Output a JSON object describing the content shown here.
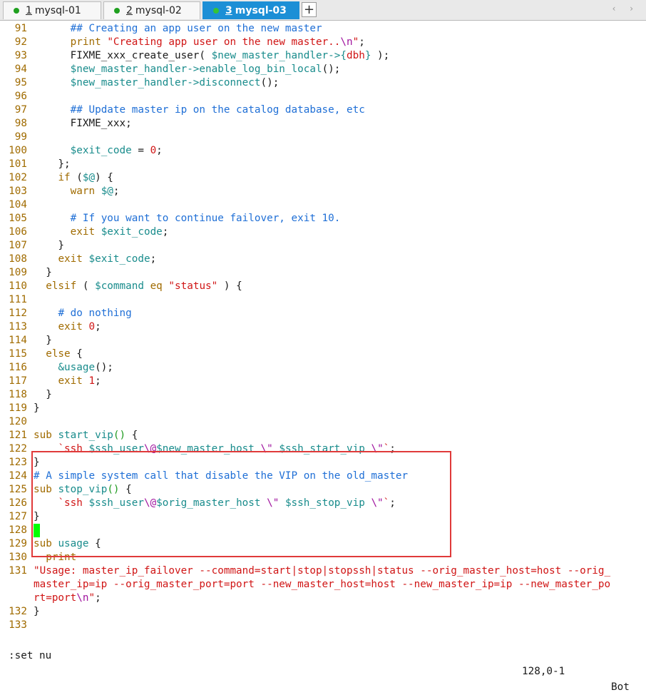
{
  "tabs": [
    {
      "number": "1",
      "label": "mysql-01",
      "active": false
    },
    {
      "number": "2",
      "label": "mysql-02",
      "active": false
    },
    {
      "number": "3",
      "label": "mysql-03",
      "active": true
    }
  ],
  "tab_add_label": "+",
  "tab_scroll_arrows": "‹ ›",
  "colors": {
    "comment": "#1f6fd6",
    "keyword": "#a06b00",
    "string": "#d01515",
    "variable": "#198c8c",
    "escape": "#a0149f",
    "cursor": "#00ff00",
    "highlight": "#e03a3a",
    "active_tab": "#1c8fd6"
  },
  "lines": [
    {
      "n": "91",
      "t": [
        [
          "      ",
          ""
        ],
        [
          "## Creating an app user on the new master",
          "cm"
        ]
      ]
    },
    {
      "n": "92",
      "t": [
        [
          "      ",
          ""
        ],
        [
          "print",
          "kw"
        ],
        [
          " ",
          ""
        ],
        [
          "\"Creating app user on the new master..",
          "str"
        ],
        [
          "\\n",
          "esc"
        ],
        [
          "\"",
          "str"
        ],
        [
          ";",
          ""
        ]
      ]
    },
    {
      "n": "93",
      "t": [
        [
          "      FIXME_xxx_create_user( ",
          ""
        ],
        [
          "$new_master_handler->{",
          "var"
        ],
        [
          "dbh",
          "str"
        ],
        [
          "}",
          "var"
        ],
        [
          " );",
          ""
        ]
      ]
    },
    {
      "n": "94",
      "t": [
        [
          "      ",
          ""
        ],
        [
          "$new_master_handler->enable_log_bin_local",
          "var"
        ],
        [
          "();",
          ""
        ]
      ]
    },
    {
      "n": "95",
      "t": [
        [
          "      ",
          ""
        ],
        [
          "$new_master_handler->disconnect",
          "var"
        ],
        [
          "();",
          ""
        ]
      ]
    },
    {
      "n": "96",
      "t": [
        [
          "",
          ""
        ]
      ]
    },
    {
      "n": "97",
      "t": [
        [
          "      ",
          ""
        ],
        [
          "## Update master ip on the catalog database, etc",
          "cm"
        ]
      ]
    },
    {
      "n": "98",
      "t": [
        [
          "      FIXME_xxx;",
          ""
        ]
      ]
    },
    {
      "n": "99",
      "t": [
        [
          "",
          ""
        ]
      ]
    },
    {
      "n": "100",
      "t": [
        [
          "      ",
          ""
        ],
        [
          "$exit_code",
          "var"
        ],
        [
          " = ",
          ""
        ],
        [
          "0",
          "str"
        ],
        [
          ";",
          ""
        ]
      ]
    },
    {
      "n": "101",
      "t": [
        [
          "    };",
          ""
        ]
      ]
    },
    {
      "n": "102",
      "t": [
        [
          "    ",
          ""
        ],
        [
          "if",
          "kw"
        ],
        [
          " (",
          ""
        ],
        [
          "$@",
          "var"
        ],
        [
          ") {",
          ""
        ]
      ]
    },
    {
      "n": "103",
      "t": [
        [
          "      ",
          ""
        ],
        [
          "warn",
          "kw"
        ],
        [
          " ",
          ""
        ],
        [
          "$@",
          "var"
        ],
        [
          ";",
          ""
        ]
      ]
    },
    {
      "n": "104",
      "t": [
        [
          "",
          ""
        ]
      ]
    },
    {
      "n": "105",
      "t": [
        [
          "      ",
          ""
        ],
        [
          "# If you want to continue failover, exit 10.",
          "cm"
        ]
      ]
    },
    {
      "n": "106",
      "t": [
        [
          "      ",
          ""
        ],
        [
          "exit",
          "kw"
        ],
        [
          " ",
          ""
        ],
        [
          "$exit_code",
          "var"
        ],
        [
          ";",
          ""
        ]
      ]
    },
    {
      "n": "107",
      "t": [
        [
          "    }",
          ""
        ]
      ]
    },
    {
      "n": "108",
      "t": [
        [
          "    ",
          ""
        ],
        [
          "exit",
          "kw"
        ],
        [
          " ",
          ""
        ],
        [
          "$exit_code",
          "var"
        ],
        [
          ";",
          ""
        ]
      ]
    },
    {
      "n": "109",
      "t": [
        [
          "  }",
          ""
        ]
      ]
    },
    {
      "n": "110",
      "t": [
        [
          "  ",
          ""
        ],
        [
          "elsif",
          "kw"
        ],
        [
          " ( ",
          ""
        ],
        [
          "$command",
          "var"
        ],
        [
          " ",
          ""
        ],
        [
          "eq",
          "kw"
        ],
        [
          " ",
          ""
        ],
        [
          "\"status\"",
          "str"
        ],
        [
          " ) {",
          ""
        ]
      ]
    },
    {
      "n": "111",
      "t": [
        [
          "",
          ""
        ]
      ]
    },
    {
      "n": "112",
      "t": [
        [
          "    ",
          ""
        ],
        [
          "# do nothing",
          "cm"
        ]
      ]
    },
    {
      "n": "113",
      "t": [
        [
          "    ",
          ""
        ],
        [
          "exit",
          "kw"
        ],
        [
          " ",
          ""
        ],
        [
          "0",
          "str"
        ],
        [
          ";",
          ""
        ]
      ]
    },
    {
      "n": "114",
      "t": [
        [
          "  }",
          ""
        ]
      ]
    },
    {
      "n": "115",
      "t": [
        [
          "  ",
          ""
        ],
        [
          "else",
          "kw"
        ],
        [
          " {",
          ""
        ]
      ]
    },
    {
      "n": "116",
      "t": [
        [
          "    ",
          ""
        ],
        [
          "&usage",
          "var"
        ],
        [
          "();",
          ""
        ]
      ]
    },
    {
      "n": "117",
      "t": [
        [
          "    ",
          ""
        ],
        [
          "exit",
          "kw"
        ],
        [
          " ",
          ""
        ],
        [
          "1",
          "str"
        ],
        [
          ";",
          ""
        ]
      ]
    },
    {
      "n": "118",
      "t": [
        [
          "  }",
          ""
        ]
      ]
    },
    {
      "n": "119",
      "t": [
        [
          "}",
          ""
        ]
      ]
    },
    {
      "n": "120",
      "t": [
        [
          "",
          ""
        ]
      ]
    },
    {
      "n": "121",
      "t": [
        [
          "sub",
          "kw"
        ],
        [
          " ",
          ""
        ],
        [
          "start_vip",
          "fn"
        ],
        [
          "()",
          "par"
        ],
        [
          " {",
          ""
        ]
      ]
    },
    {
      "n": "122",
      "t": [
        [
          "    ",
          ""
        ],
        [
          "`ssh ",
          "str"
        ],
        [
          "$ssh_user",
          "var"
        ],
        [
          "\\@",
          "esc"
        ],
        [
          "$new_master_host",
          "var"
        ],
        [
          " ",
          ""
        ],
        [
          "\\\"",
          "esc"
        ],
        [
          " ",
          ""
        ],
        [
          "$ssh_start_vip",
          "var"
        ],
        [
          " ",
          ""
        ],
        [
          "\\\"",
          "esc"
        ],
        [
          "`",
          "str"
        ],
        [
          ";",
          ""
        ]
      ]
    },
    {
      "n": "123",
      "t": [
        [
          "}",
          ""
        ]
      ]
    },
    {
      "n": "124",
      "t": [
        [
          "# A simple system call that disable the VIP on the old_master",
          "cm"
        ]
      ]
    },
    {
      "n": "125",
      "t": [
        [
          "sub",
          "kw"
        ],
        [
          " ",
          ""
        ],
        [
          "stop_vip",
          "fn"
        ],
        [
          "()",
          "par"
        ],
        [
          " {",
          ""
        ]
      ]
    },
    {
      "n": "126",
      "t": [
        [
          "    ",
          ""
        ],
        [
          "`ssh ",
          "str"
        ],
        [
          "$ssh_user",
          "var"
        ],
        [
          "\\@",
          "esc"
        ],
        [
          "$orig_master_host",
          "var"
        ],
        [
          " ",
          ""
        ],
        [
          "\\\"",
          "esc"
        ],
        [
          " ",
          ""
        ],
        [
          "$ssh_stop_vip",
          "var"
        ],
        [
          " ",
          ""
        ],
        [
          "\\\"",
          "esc"
        ],
        [
          "`",
          "str"
        ],
        [
          ";",
          ""
        ]
      ]
    },
    {
      "n": "127",
      "t": [
        [
          "}",
          ""
        ]
      ]
    },
    {
      "n": "128",
      "t": [
        [
          " ",
          "cursor"
        ]
      ]
    },
    {
      "n": "129",
      "t": [
        [
          "sub",
          "kw"
        ],
        [
          " ",
          ""
        ],
        [
          "usage",
          "fn"
        ],
        [
          " {",
          ""
        ]
      ]
    },
    {
      "n": "130",
      "t": [
        [
          "  ",
          ""
        ],
        [
          "print",
          "kw"
        ]
      ]
    },
    {
      "n": "131",
      "t": [
        [
          "\"Usage: master_ip_failover --command=start|stop|stopssh|status --orig_master_host=host --orig_",
          "str"
        ]
      ]
    },
    {
      "n": "",
      "t": [
        [
          "master_ip=ip --orig_master_port=port --new_master_host=host --new_master_ip=ip --new_master_po",
          "str"
        ]
      ]
    },
    {
      "n": "",
      "t": [
        [
          "rt=port",
          "str"
        ],
        [
          "\\n",
          "esc"
        ],
        [
          "\"",
          "str"
        ],
        [
          ";",
          ""
        ]
      ]
    },
    {
      "n": "132",
      "t": [
        [
          "}",
          ""
        ]
      ]
    },
    {
      "n": "133",
      "t": [
        [
          "",
          ""
        ]
      ]
    }
  ],
  "statusline": {
    "command": ":set nu",
    "position": "128,0-1",
    "scroll": "Bot"
  }
}
